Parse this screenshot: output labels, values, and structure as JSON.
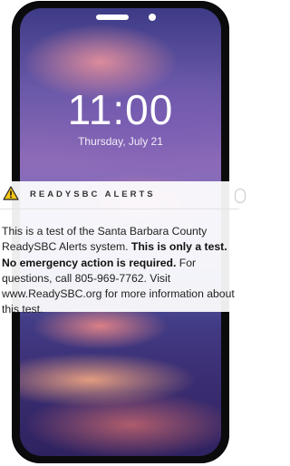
{
  "lockscreen": {
    "time": "11:00",
    "date": "Thursday, July 21"
  },
  "alert": {
    "title": "READYSBC ALERTS",
    "icon": "warning-icon",
    "body_intro": "This is a test of the Santa Barbara County ReadySBC Alerts system. ",
    "body_bold": "This is only a test. No emergency action is required.",
    "body_outro": " For questions, call 805-969-7762. Visit www.ReadySBC.org for more information about this test."
  },
  "colors": {
    "warning_yellow": "#f5c518",
    "phone_frame": "#0b0b0d"
  }
}
